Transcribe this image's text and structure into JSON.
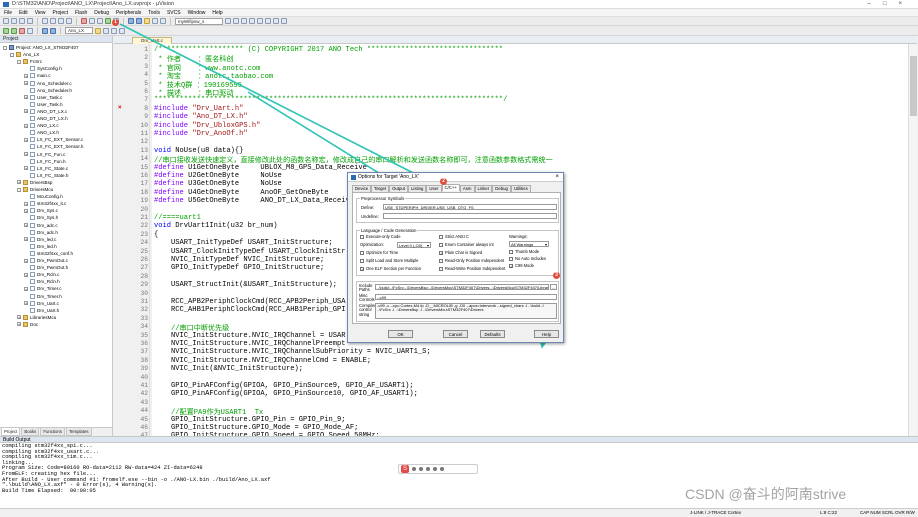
{
  "window": {
    "title": "D:\\STM32\\ANO\\Project\\ANO_LX\\Project\\Ano_LX.uvprojx - µVision"
  },
  "menu": [
    "File",
    "Edit",
    "View",
    "Project",
    "Flash",
    "Debug",
    "Peripherals",
    "Tools",
    "SVCS",
    "Window",
    "Help"
  ],
  "toolbar": {
    "target": "Ano_LX",
    "combo": "myWifipsw_s"
  },
  "project": {
    "header": "Project",
    "nodes": [
      {
        "l": "Project: ANO_LX_STM32F407",
        "d": 0,
        "t": "proj",
        "e": "-"
      },
      {
        "l": "Ano_LX",
        "d": 1,
        "t": "folder",
        "e": "-"
      },
      {
        "l": "FcSrc",
        "d": 2,
        "t": "folder",
        "e": "-"
      },
      {
        "l": "SysConfig.h",
        "d": 3,
        "t": "file",
        "e": ""
      },
      {
        "l": "main.c",
        "d": 3,
        "t": "file",
        "e": "+"
      },
      {
        "l": "Ano_Scheduler.c",
        "d": 3,
        "t": "file",
        "e": "+"
      },
      {
        "l": "Ano_Scheduler.h",
        "d": 3,
        "t": "file",
        "e": ""
      },
      {
        "l": "User_Task.c",
        "d": 3,
        "t": "file",
        "e": "+"
      },
      {
        "l": "User_Task.h",
        "d": 3,
        "t": "file",
        "e": ""
      },
      {
        "l": "ANO_DT_LX.c",
        "d": 3,
        "t": "file",
        "e": "+"
      },
      {
        "l": "ANO_DT_LX.h",
        "d": 3,
        "t": "file",
        "e": ""
      },
      {
        "l": "ANO_LX.c",
        "d": 3,
        "t": "file",
        "e": "+"
      },
      {
        "l": "ANO_LX.h",
        "d": 3,
        "t": "file",
        "e": ""
      },
      {
        "l": "LX_FC_EXT_Sensor.c",
        "d": 3,
        "t": "file",
        "e": "+"
      },
      {
        "l": "LX_FC_EXT_Sensor.h",
        "d": 3,
        "t": "file",
        "e": ""
      },
      {
        "l": "LX_FC_Fun.c",
        "d": 3,
        "t": "file",
        "e": "+"
      },
      {
        "l": "LX_FC_Fun.h",
        "d": 3,
        "t": "file",
        "e": ""
      },
      {
        "l": "LX_FC_State.c",
        "d": 3,
        "t": "file",
        "e": "+"
      },
      {
        "l": "LX_FC_State.h",
        "d": 3,
        "t": "file",
        "e": ""
      },
      {
        "l": "DriversBsp",
        "d": 2,
        "t": "folder",
        "e": "+"
      },
      {
        "l": "DriversMcu",
        "d": 2,
        "t": "folder",
        "e": "-"
      },
      {
        "l": "McuConfig.h",
        "d": 3,
        "t": "file",
        "e": ""
      },
      {
        "l": "stm32f4xx_it.c",
        "d": 3,
        "t": "file",
        "e": "+"
      },
      {
        "l": "Drv_Sys.c",
        "d": 3,
        "t": "file",
        "e": "+"
      },
      {
        "l": "Drv_Sys.h",
        "d": 3,
        "t": "file",
        "e": ""
      },
      {
        "l": "Drv_adc.c",
        "d": 3,
        "t": "file",
        "e": "+"
      },
      {
        "l": "Drv_adc.h",
        "d": 3,
        "t": "file",
        "e": ""
      },
      {
        "l": "Drv_led.c",
        "d": 3,
        "t": "file",
        "e": "+"
      },
      {
        "l": "Drv_led.h",
        "d": 3,
        "t": "file",
        "e": ""
      },
      {
        "l": "stm32f4xx_conf.h",
        "d": 3,
        "t": "file",
        "e": ""
      },
      {
        "l": "Drv_PwmOut.c",
        "d": 3,
        "t": "file",
        "e": "+"
      },
      {
        "l": "Drv_PwmOut.h",
        "d": 3,
        "t": "file",
        "e": ""
      },
      {
        "l": "Drv_Rcln.c",
        "d": 3,
        "t": "file",
        "e": "+"
      },
      {
        "l": "Drv_Rcln.h",
        "d": 3,
        "t": "file",
        "e": ""
      },
      {
        "l": "Drv_Timer.c",
        "d": 3,
        "t": "file",
        "e": "+"
      },
      {
        "l": "Drv_Timer.h",
        "d": 3,
        "t": "file",
        "e": ""
      },
      {
        "l": "Drv_Uart.c",
        "d": 3,
        "t": "file",
        "e": "+"
      },
      {
        "l": "Drv_Uart.h",
        "d": 3,
        "t": "file",
        "e": ""
      },
      {
        "l": "LibrariesMcu",
        "d": 2,
        "t": "folder",
        "e": "+"
      },
      {
        "l": "Doc",
        "d": 2,
        "t": "folder",
        "e": "+"
      }
    ],
    "tabs": [
      "Project",
      "Books",
      "Functions",
      "Templates"
    ]
  },
  "editor": {
    "tab": "Drv_Uart.c",
    "lines": [
      {
        "n": "1",
        "s": [
          [
            "cc",
            "/******************** (C) COPYRIGHT 2017 ANO Tech ********************************"
          ]
        ]
      },
      {
        "n": "2",
        "s": [
          [
            "cc",
            " * 作者    ：匿名科创"
          ]
        ]
      },
      {
        "n": "3",
        "s": [
          [
            "cc",
            " * 官网    ：www.anotc.com"
          ]
        ]
      },
      {
        "n": "4",
        "s": [
          [
            "cc",
            " * 淘宝    ：anotc.taobao.com"
          ]
        ]
      },
      {
        "n": "5",
        "s": [
          [
            "cc",
            " * 技术Q群 ：190169595"
          ]
        ]
      },
      {
        "n": "6",
        "s": [
          [
            "cc",
            " * 描述    ：串口驱动"
          ]
        ]
      },
      {
        "n": "7",
        "s": [
          [
            "cc",
            "**********************************************************************************/"
          ]
        ]
      },
      {
        "n": "8",
        "s": [
          [
            "cpp",
            "#include "
          ],
          [
            "cs",
            "\"Drv_Uart.h\""
          ]
        ],
        "err": true
      },
      {
        "n": "9",
        "s": [
          [
            "cpp",
            "#include "
          ],
          [
            "cs",
            "\"Ano_DT_LX.h\""
          ]
        ]
      },
      {
        "n": "10",
        "s": [
          [
            "cpp",
            "#include "
          ],
          [
            "cs",
            "\"Drv_UbloxGPS.h\""
          ]
        ]
      },
      {
        "n": "11",
        "s": [
          [
            "cpp",
            "#include "
          ],
          [
            "cs",
            "\"Drv_AnoOf.h\""
          ]
        ]
      },
      {
        "n": "12",
        "s": [
          [
            "",
            ""
          ]
        ]
      },
      {
        "n": "13",
        "s": [
          [
            "ck",
            "void"
          ],
          [
            "",
            " NoUse(u8 data){}"
          ]
        ]
      },
      {
        "n": "14",
        "s": [
          [
            "cc",
            "//串口接收发送快速定义，直接修改此处的函数名称宏，修改成自己的串口解析和发送函数名称即可，注意函数参数格式需统一"
          ]
        ]
      },
      {
        "n": "15",
        "s": [
          [
            "cpp",
            "#define"
          ],
          [
            "",
            " U1GetOneByte     UBLOX_M8_GPS_Data_Receive"
          ]
        ]
      },
      {
        "n": "16",
        "s": [
          [
            "cpp",
            "#define"
          ],
          [
            "",
            " U2GetOneByte     NoUse"
          ]
        ]
      },
      {
        "n": "17",
        "s": [
          [
            "cpp",
            "#define"
          ],
          [
            "",
            " U3GetOneByte     NoUse"
          ]
        ]
      },
      {
        "n": "18",
        "s": [
          [
            "cpp",
            "#define"
          ],
          [
            "",
            " U4GetOneByte     AnoOF_GetOneByte"
          ]
        ]
      },
      {
        "n": "19",
        "s": [
          [
            "cpp",
            "#define"
          ],
          [
            "",
            " U5GetOneByte     ANO_DT_LX_Data_Receive"
          ]
        ]
      },
      {
        "n": "20",
        "s": [
          [
            "",
            ""
          ]
        ]
      },
      {
        "n": "21",
        "s": [
          [
            "cc",
            "//====uart1"
          ]
        ]
      },
      {
        "n": "22",
        "s": [
          [
            "ck",
            "void"
          ],
          [
            "",
            " DrvUart1Init(u32 br_num)"
          ]
        ]
      },
      {
        "n": "23",
        "s": [
          [
            "",
            "{"
          ]
        ]
      },
      {
        "n": "24",
        "s": [
          [
            "",
            "    USART_InitTypeDef USART_InitStructure;"
          ]
        ]
      },
      {
        "n": "25",
        "s": [
          [
            "",
            "    USART_ClockInitTypeDef USART_ClockInitStr"
          ]
        ]
      },
      {
        "n": "26",
        "s": [
          [
            "",
            "    NVIC_InitTypeDef NVIC_InitStructure;"
          ]
        ]
      },
      {
        "n": "27",
        "s": [
          [
            "",
            "    GPIO_InitTypeDef GPIO_InitStructure;"
          ]
        ]
      },
      {
        "n": "28",
        "s": [
          [
            "",
            ""
          ]
        ]
      },
      {
        "n": "29",
        "s": [
          [
            "",
            "    USART_StructInit(&USART_InitStructure);"
          ]
        ]
      },
      {
        "n": "30",
        "s": [
          [
            "",
            ""
          ]
        ]
      },
      {
        "n": "31",
        "s": [
          [
            "",
            "    RCC_APB2PeriphClockCmd(RCC_APB2Periph_USA"
          ]
        ]
      },
      {
        "n": "32",
        "s": [
          [
            "",
            "    RCC_AHB1PeriphClockCmd(RCC_AHB1Periph_GPI"
          ]
        ]
      },
      {
        "n": "33",
        "s": [
          [
            "",
            ""
          ]
        ]
      },
      {
        "n": "34",
        "s": [
          [
            "cc",
            "    //串口中断优先级"
          ]
        ]
      },
      {
        "n": "35",
        "s": [
          [
            "",
            "    NVIC_InitStructure.NVIC_IRQChannel = USAR"
          ]
        ]
      },
      {
        "n": "36",
        "s": [
          [
            "",
            "    NVIC_InitStructure.NVIC_IRQChannelPreempt"
          ]
        ]
      },
      {
        "n": "37",
        "s": [
          [
            "",
            "    NVIC_InitStructure.NVIC_IRQChannelSubPriority = NVIC_UART1_S;"
          ]
        ]
      },
      {
        "n": "38",
        "s": [
          [
            "",
            "    NVIC_InitStructure.NVIC_IRQChannelCmd = ENABLE;"
          ]
        ]
      },
      {
        "n": "39",
        "s": [
          [
            "",
            "    NVIC_Init(&NVIC_InitStructure);"
          ]
        ]
      },
      {
        "n": "40",
        "s": [
          [
            "",
            ""
          ]
        ]
      },
      {
        "n": "41",
        "s": [
          [
            "",
            "    GPIO_PinAFConfig(GPIOA, GPIO_PinSource9, GPIO_AF_USART1);"
          ]
        ]
      },
      {
        "n": "42",
        "s": [
          [
            "",
            "    GPIO_PinAFConfig(GPIOA, GPIO_PinSource10, GPIO_AF_USART1);"
          ]
        ]
      },
      {
        "n": "43",
        "s": [
          [
            "",
            ""
          ]
        ]
      },
      {
        "n": "44",
        "s": [
          [
            "cc",
            "    //配置PA9作为USART1  Tx"
          ]
        ]
      },
      {
        "n": "45",
        "s": [
          [
            "",
            "    GPIO_InitStructure.GPIO_Pin = GPIO_Pin_9;"
          ]
        ]
      },
      {
        "n": "46",
        "s": [
          [
            "",
            "    GPIO_InitStructure.GPIO_Mode = GPIO_Mode_AF;"
          ]
        ]
      },
      {
        "n": "47",
        "s": [
          [
            "",
            "    GPIO_InitStructure.GPIO_Speed = GPIO_Speed_50MHz;"
          ]
        ]
      }
    ]
  },
  "dialog": {
    "title": "Options for Target 'Ano_LX'",
    "tabs": [
      "Device",
      "Target",
      "Output",
      "Listing",
      "User",
      "C/C++",
      "Asm",
      "Linker",
      "Debug",
      "Utilities"
    ],
    "preproc_label": "Preprocessor Symbols",
    "define_label": "Define:",
    "define_value": "USE_STDPERIPH_DRIVER,USE_USB_OTG_FS",
    "undefine_label": "Undefine:",
    "undefine_value": "",
    "lang_label": "Language / Code Generation",
    "checks_left": [
      {
        "l": "Execute-only Code",
        "c": false
      },
      {
        "l": "Optimization:",
        "c": null
      },
      {
        "l": "Optimize for Time",
        "c": false
      },
      {
        "l": "Split Load and Store Multiple",
        "c": false
      },
      {
        "l": "One ELF Section per Function",
        "c": true
      }
    ],
    "opt_value": "Level 0 (-O0)",
    "checks_mid": [
      {
        "l": "Strict ANSI C",
        "c": false
      },
      {
        "l": "Enum Container always int",
        "c": false
      },
      {
        "l": "Plain Char is Signed",
        "c": true
      },
      {
        "l": "Read-Only Position Independent",
        "c": false
      },
      {
        "l": "Read-Write Position Independent",
        "c": false
      }
    ],
    "warn_label": "Warnings:",
    "warn_value": "All Warnings",
    "checks_right": [
      {
        "l": "Thumb Mode",
        "c": false
      },
      {
        "l": "No Auto Includes",
        "c": false
      },
      {
        "l": "C99 Mode",
        "c": true
      }
    ],
    "include_label": "Include Paths",
    "include_value": "..\\build;..\\FcSrc;..\\DriversBsp;..\\DriversMcu\\STM32F407\\Drivers;..\\DriversMcu\\STM32F407\\Libraries",
    "misc_label": "Misc Controls",
    "misc_value": "--c99",
    "compiler_label": "Compiler control string",
    "compiler_value": "-c99 -c --cpu Cortex-M4.fp -D__MICROLIB -g -O0 --apcs=interwork --signed_chars -I ..\\build -I ..\\FcSrc -I ..\\DriversBsp -I ..\\DriversMcu\\STM32F407\\Drivers",
    "buttons": [
      "OK",
      "Cancel",
      "Defaults",
      "Help"
    ]
  },
  "markers": [
    "1",
    "2",
    "3"
  ],
  "build": {
    "header": "Build Output",
    "lines": [
      "compiling stm32f4xx_spi.c...",
      "compiling stm32f4xx_usart.c...",
      "compiling stm32f4xx_tim.c...",
      "linking...",
      "Program Size: Code=80160 RO-data=2112 RW-data=424 ZI-data=6248",
      "FromELF: creating hex file...",
      "After Build - User command #1: fromelf.exe --bin -o ./ANO-LX.bin ./build/Ano_LX.axf",
      "\".\\build\\ANO_LX.axf\" - 0 Error(s), 4 Warning(s).",
      "Build Time Elapsed:  00:00:05"
    ]
  },
  "status": {
    "a": "J-LINK / J-TRACE Cortex",
    "b": "L:8 C:22",
    "c": "CAP  NUM  SCRL  OVR  R/W"
  },
  "watermark": "CSDN @奋斗的阿南strive",
  "colors": {
    "arrow": "#2ec4b6",
    "marker": "#e24b3b",
    "comment": "#00a000",
    "keyword": "#0000ff",
    "string": "#a31515",
    "preproc": "#8000ff"
  }
}
